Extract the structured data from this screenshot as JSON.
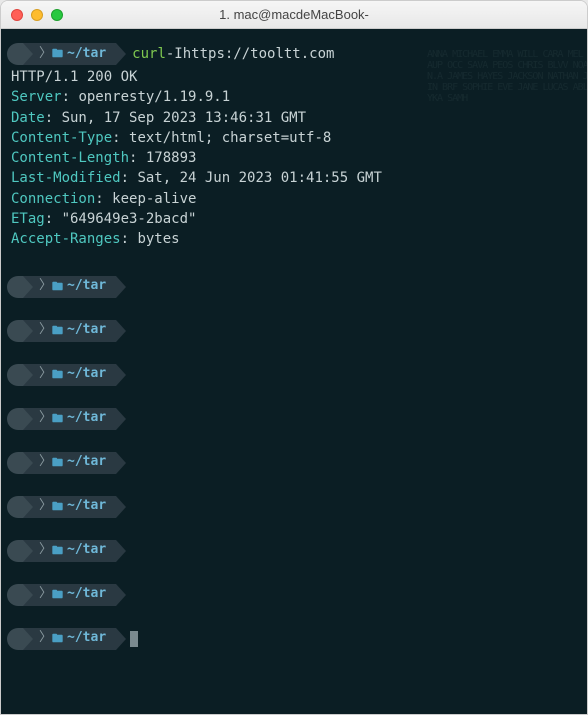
{
  "titlebar": {
    "title": "1. mac@macdeMacBook-"
  },
  "prompt": {
    "apple_glyph": "",
    "folder_glyph": "🖿",
    "path_tilde": "~",
    "path_slash": "/",
    "path_dir": "tar"
  },
  "command": {
    "name": "curl",
    "flag": " -I  ",
    "url": "https://tooltt.com"
  },
  "response": {
    "status": "HTTP/1.1 200 OK",
    "headers": [
      {
        "key": "Server",
        "val": "openresty/1.19.9.1"
      },
      {
        "key": "Date",
        "val": "Sun, 17 Sep 2023 13:46:31 GMT"
      },
      {
        "key": "Content-Type",
        "val": "text/html; charset=utf-8"
      },
      {
        "key": "Content-Length",
        "val": "178893"
      },
      {
        "key": "Last-Modified",
        "val": "Sat, 24 Jun 2023 01:41:55 GMT"
      },
      {
        "key": "Connection",
        "val": "keep-alive"
      },
      {
        "key": "ETag",
        "val": "\"649649e3-2bacd\""
      },
      {
        "key": "Accept-Ranges",
        "val": "bytes"
      }
    ]
  },
  "empty_prompt_count": 9
}
